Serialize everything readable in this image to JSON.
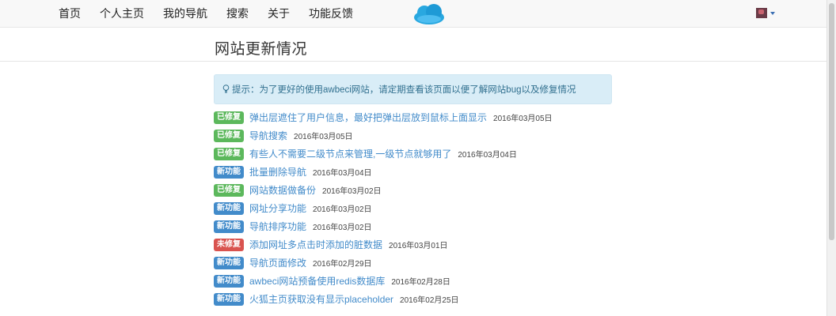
{
  "nav": {
    "links": [
      "首页",
      "个人主页",
      "我的导航",
      "搜索",
      "关于",
      "功能反馈"
    ]
  },
  "header": {
    "title": "网站更新情况"
  },
  "alert": {
    "text": "提示：为了更好的使用awbeci网站，请定期查看该页面以便了解网站bug以及修复情况"
  },
  "colors": {
    "fixed": "#5cb85c",
    "new": "#428bca",
    "unfixed": "#d9534f",
    "link": "#428bca",
    "alert_bg": "#d9edf7"
  },
  "updates": [
    {
      "badge": "已修复",
      "status": "fixed",
      "title": "弹出层遮住了用户信息，最好把弹出层放到鼠标上面显示",
      "date": "2016年03月05日"
    },
    {
      "badge": "已修复",
      "status": "fixed",
      "title": "导航搜索",
      "date": "2016年03月05日"
    },
    {
      "badge": "已修复",
      "status": "fixed",
      "title": "有些人不需要二级节点来管理,一级节点就够用了",
      "date": "2016年03月04日"
    },
    {
      "badge": "新功能",
      "status": "new",
      "title": "批量删除导航",
      "date": "2016年03月04日"
    },
    {
      "badge": "已修复",
      "status": "fixed",
      "title": "网站数据做备份",
      "date": "2016年03月02日"
    },
    {
      "badge": "新功能",
      "status": "new",
      "title": "网址分享功能",
      "date": "2016年03月02日"
    },
    {
      "badge": "新功能",
      "status": "new",
      "title": "导航排序功能",
      "date": "2016年03月02日"
    },
    {
      "badge": "未修复",
      "status": "unfixed",
      "title": "添加网址多点击时添加的脏数据",
      "date": "2016年03月01日"
    },
    {
      "badge": "新功能",
      "status": "new",
      "title": "导航页面修改",
      "date": "2016年02月29日"
    },
    {
      "badge": "新功能",
      "status": "new",
      "title": "awbeci网站预备使用redis数据库",
      "date": "2016年02月28日"
    },
    {
      "badge": "新功能",
      "status": "new",
      "title": "火狐主页获取没有显示placeholder",
      "date": "2016年02月25日"
    }
  ]
}
